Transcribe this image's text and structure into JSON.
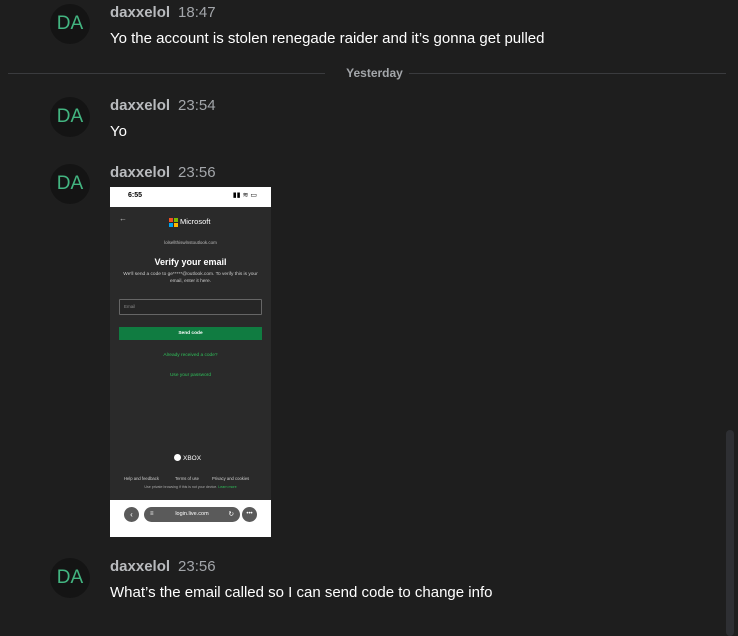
{
  "author": "daxxelol",
  "avatar_initials": "DA",
  "colors": {
    "background": "#1e1e1e",
    "avatar_text": "#43b581",
    "send_button": "#107c41",
    "link_green": "#2fbf5a"
  },
  "messages": [
    {
      "time": "18:47",
      "text": "Yo the account is stolen renegade raider and it’s gonna get pulled"
    },
    {
      "time": "23:54",
      "text": "Yo"
    },
    {
      "time": "23:56",
      "attachment": "phone-screenshot"
    },
    {
      "time": "23:56",
      "text": "What’s the email called so I can send code to change info"
    }
  ],
  "divider": {
    "label": "Yesterday"
  },
  "screenshot": {
    "status_time": "6:55",
    "status_icons": "▮▮ ≋ ▭",
    "back_icon": "back-arrow-icon",
    "brand": "Microsoft",
    "account": "lolsellthiswlnstoutlook.com",
    "title": "Verify your email",
    "description": "We'll send a code to ge*****@outlook.com. To verify this is your email, enter it here.",
    "email_placeholder": "Email",
    "send_button": "Send code",
    "link_already": "Already received a code?",
    "link_password": "Use your password",
    "xbox_label": "XBOX",
    "footer_help": "Help and feedback",
    "footer_terms": "Terms of use",
    "footer_privacy": "Privacy and cookies",
    "footer_note": "Use private browsing if this is not your device.",
    "footer_learn_more": "Learn more",
    "url": "login.live.com"
  }
}
